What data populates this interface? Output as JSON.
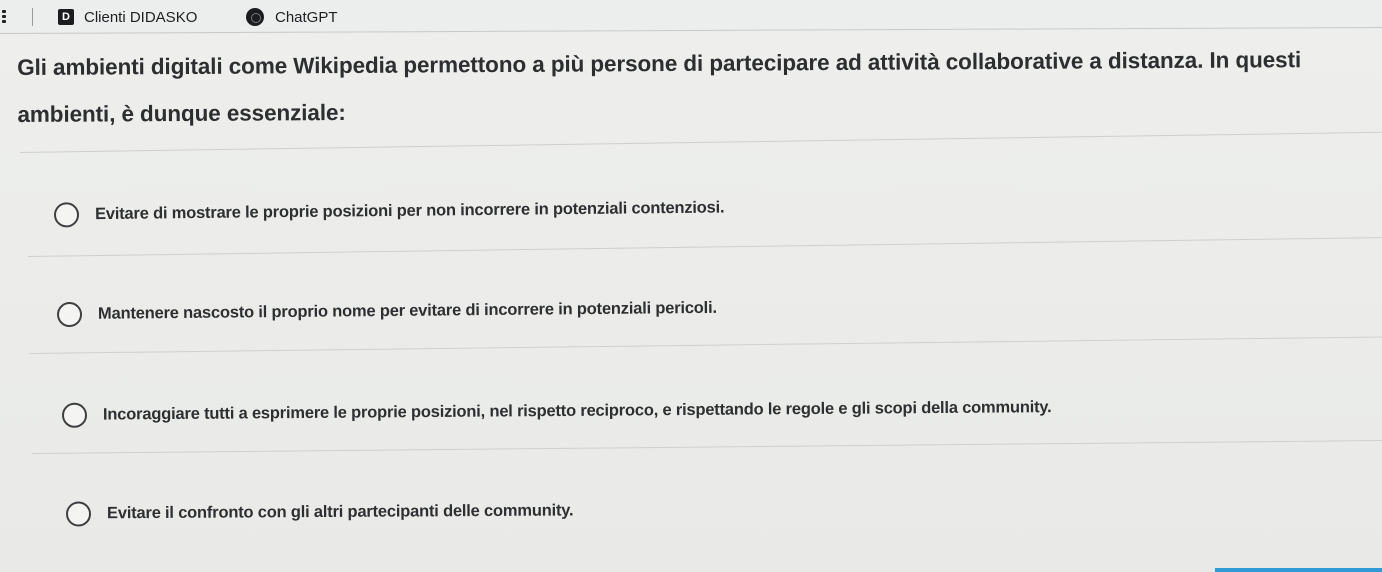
{
  "bookmarks": [
    {
      "label": "Clienti DIDASKO",
      "icon": "didasko-favicon-icon",
      "icon_letter": "D"
    },
    {
      "label": "ChatGPT",
      "icon": "chatgpt-favicon-icon"
    }
  ],
  "question": {
    "text": "Gli ambienti digitali come Wikipedia permettono a più persone di partecipare ad attività collaborative a distanza. In questi ambienti, è dunque essenziale:"
  },
  "options": [
    {
      "label": "Evitare di mostrare le proprie posizioni per non incorrere in potenziali contenziosi.",
      "selected": false
    },
    {
      "label": "Mantenere nascosto il proprio nome per evitare di incorrere in potenziali pericoli.",
      "selected": false
    },
    {
      "label": "Incoraggiare tutti a esprimere le proprie posizioni, nel rispetto reciproco, e rispettando le regole e gli scopi della community.",
      "selected": false
    },
    {
      "label": "Evitare il confronto con gli altri partecipanti delle community.",
      "selected": false
    }
  ],
  "colors": {
    "background": "#ecedeb",
    "text": "#2d2e30",
    "radio_border": "#3e3f41",
    "accent": "#2f9ad6"
  }
}
